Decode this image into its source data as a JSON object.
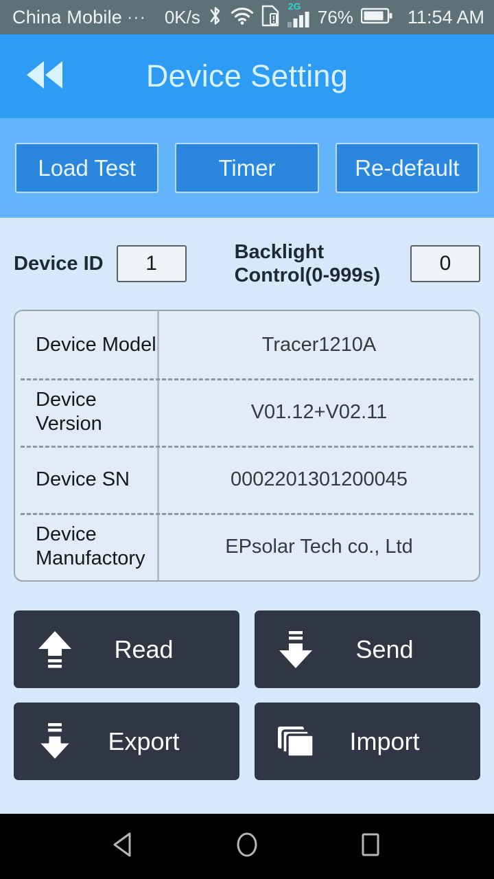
{
  "status_bar": {
    "carrier": "China Mobile",
    "carrier_overflow": "···",
    "network_speed": "0K/s",
    "network_type": "2G",
    "battery_percent": "76%",
    "time": "11:54 AM",
    "icons": [
      "bluetooth-icon",
      "wifi-icon",
      "sim-card-alert-icon",
      "signal-bars-icon",
      "battery-icon"
    ],
    "background_color": "#5e7178"
  },
  "title_bar": {
    "title": "Device Setting",
    "back_icon": "rewind-back-icon",
    "background_color": "#2e9bf5",
    "title_color": "#d8f2ff"
  },
  "top_buttons": {
    "background_color": "#63b4fb",
    "items": [
      {
        "label": "Load Test",
        "name": "load-test-button"
      },
      {
        "label": "Timer",
        "name": "timer-button"
      },
      {
        "label": "Re-default",
        "name": "re-default-button"
      }
    ]
  },
  "fields": {
    "device_id": {
      "label": "Device ID",
      "value": "1"
    },
    "backlight": {
      "label": "Backlight Control(0-999s)",
      "label_line1": "Backlight",
      "label_line2": "Control(0-999s)",
      "value": "0"
    }
  },
  "info_table": {
    "rows": [
      {
        "key": "Device Model",
        "value": "Tracer1210A"
      },
      {
        "key": "Device Version",
        "key_line1": "Device",
        "key_line2": "Version",
        "value": "V01.12+V02.11"
      },
      {
        "key": "Device SN",
        "value": "0002201301200045"
      },
      {
        "key": "Device Manufactory",
        "key_line1": "Device",
        "key_line2": "Manufactory",
        "value": "EPsolar Tech co., Ltd"
      }
    ]
  },
  "actions": [
    {
      "label": "Read",
      "name": "read-button",
      "icon": "upload-arrow-up-icon"
    },
    {
      "label": "Send",
      "name": "send-button",
      "icon": "download-arrow-down-icon"
    },
    {
      "label": "Export",
      "name": "export-button",
      "icon": "export-arrow-down-outline-icon"
    },
    {
      "label": "Import",
      "name": "import-button",
      "icon": "stacked-cards-icon"
    }
  ],
  "nav_bar": {
    "back": "nav-back-triangle-icon",
    "home": "nav-home-circle-icon",
    "recents": "nav-recents-square-icon"
  },
  "theme": {
    "page_background": "#d6e8f9",
    "accent_blue": "#2e9bf5",
    "button_dark": "#303643",
    "table_background": "#e2ecf6"
  }
}
